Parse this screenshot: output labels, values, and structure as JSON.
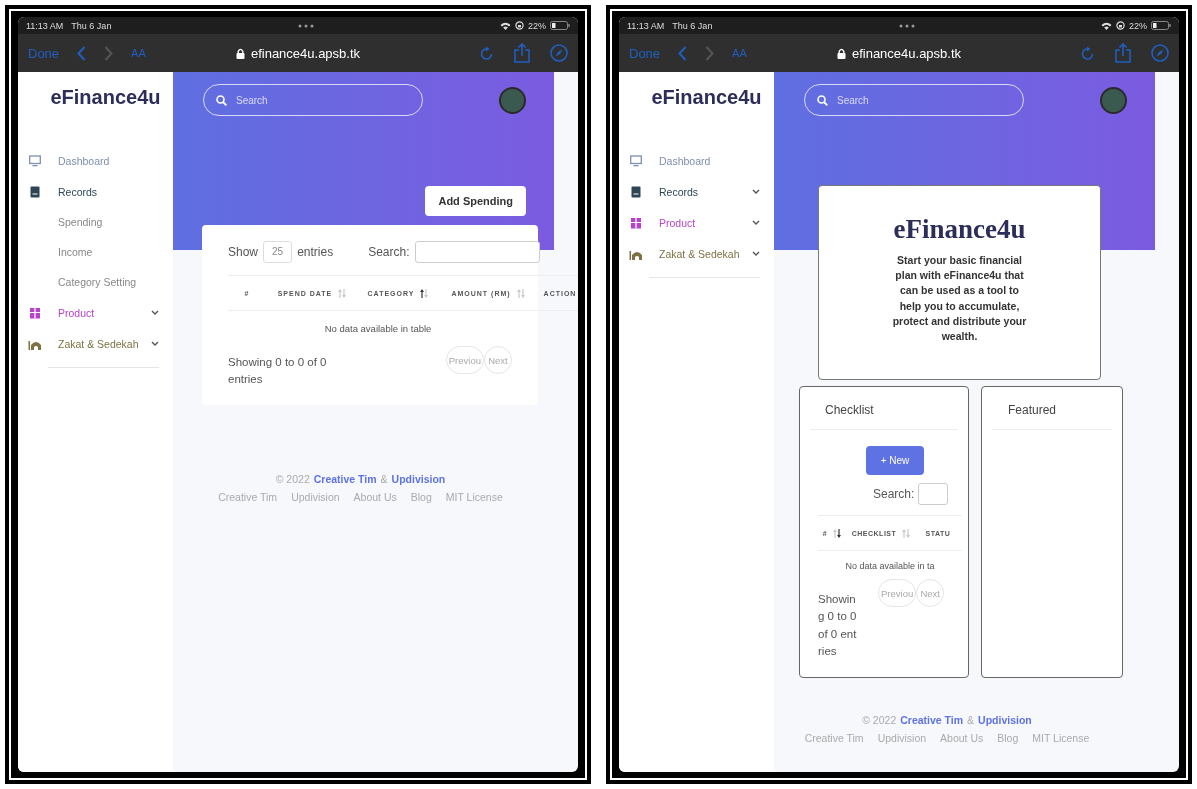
{
  "screens": [
    {
      "kind": "records",
      "status_bar": {
        "time": "11:13 AM",
        "date": "Thu 6 Jan",
        "battery": "22%"
      },
      "browser": {
        "done": "Done",
        "text_size": "AA",
        "url": "efinance4u.apsb.tk"
      },
      "sidebar": {
        "brand": "eFinance4u",
        "items": [
          {
            "label": "Dashboard",
            "kind": "monitor",
            "color": "#7e8fb0",
            "chevron": false
          },
          {
            "label": "Records",
            "kind": "book",
            "color": "#2c4656",
            "chevron": false,
            "children": [
              {
                "label": "Spending"
              },
              {
                "label": "Income"
              },
              {
                "label": "Category Setting"
              }
            ]
          },
          {
            "label": "Product",
            "kind": "box",
            "color": "#b544c9",
            "chevron": true
          },
          {
            "label": "Zakat & Sedekah",
            "kind": "mosque",
            "color": "#7d7244",
            "chevron": true
          }
        ]
      },
      "search": {
        "placeholder": "Search"
      },
      "add_button": "Add Spending",
      "table": {
        "show_label": "Show",
        "length": "25",
        "entries_label": "entries",
        "search_label": "Search:",
        "columns": [
          {
            "label": "#",
            "kind": "none"
          },
          {
            "label": "SPEND DATE",
            "kind": "both"
          },
          {
            "label": "CATEGORY",
            "kind": "asc"
          },
          {
            "label": "AMOUNT (RM)",
            "kind": "both"
          },
          {
            "label": "ACTION",
            "kind": "none"
          }
        ],
        "empty": "No data available in table",
        "info": "Showing 0 to 0 of 0 entries",
        "pager": [
          "Previou",
          "Next"
        ]
      },
      "footer": {
        "copyright": "© 2022",
        "author": "Creative Tim",
        "and": "&",
        "partner": "Updivision",
        "links": [
          "Creative Tim",
          "Updivision",
          "About Us",
          "Blog",
          "MIT License"
        ]
      }
    },
    {
      "kind": "home",
      "status_bar": {
        "time": "11:13 AM",
        "date": "Thu 6 Jan",
        "battery": "22%"
      },
      "browser": {
        "done": "Done",
        "text_size": "AA",
        "url": "efinance4u.apsb.tk"
      },
      "sidebar": {
        "brand": "eFinance4u",
        "items": [
          {
            "label": "Dashboard",
            "kind": "monitor",
            "color": "#7e8fb0",
            "chevron": false
          },
          {
            "label": "Records",
            "kind": "book",
            "color": "#2c4656",
            "chevron": true
          },
          {
            "label": "Product",
            "kind": "box",
            "color": "#b544c9",
            "chevron": true
          },
          {
            "label": "Zakat & Sedekah",
            "kind": "mosque",
            "color": "#7d7244",
            "chevron": true
          }
        ]
      },
      "search": {
        "placeholder": "Search"
      },
      "hero": {
        "title": "eFinance4u",
        "text": "Start your basic financial plan with eFinance4u that can be used as a tool to help you to accumulate, protect and distribute your wealth."
      },
      "checklist": {
        "title": "Checklist",
        "new_button": "+ New",
        "search_label": "Search:",
        "columns": [
          {
            "label": "#",
            "kind": "desc"
          },
          {
            "label": "CHECKLIST",
            "kind": "both"
          },
          {
            "label": "STATU",
            "kind": "none"
          }
        ],
        "empty": "No data available in ta",
        "info": "Showing 0 to 0 of 0 entries",
        "pager": [
          "Previou",
          "Next"
        ]
      },
      "featured": {
        "title": "Featured"
      },
      "footer": {
        "copyright": "© 2022",
        "author": "Creative Tim",
        "and": "&",
        "partner": "Updivision",
        "links": [
          "Creative Tim",
          "Updivision",
          "About Us",
          "Blog",
          "MIT License"
        ]
      }
    }
  ]
}
